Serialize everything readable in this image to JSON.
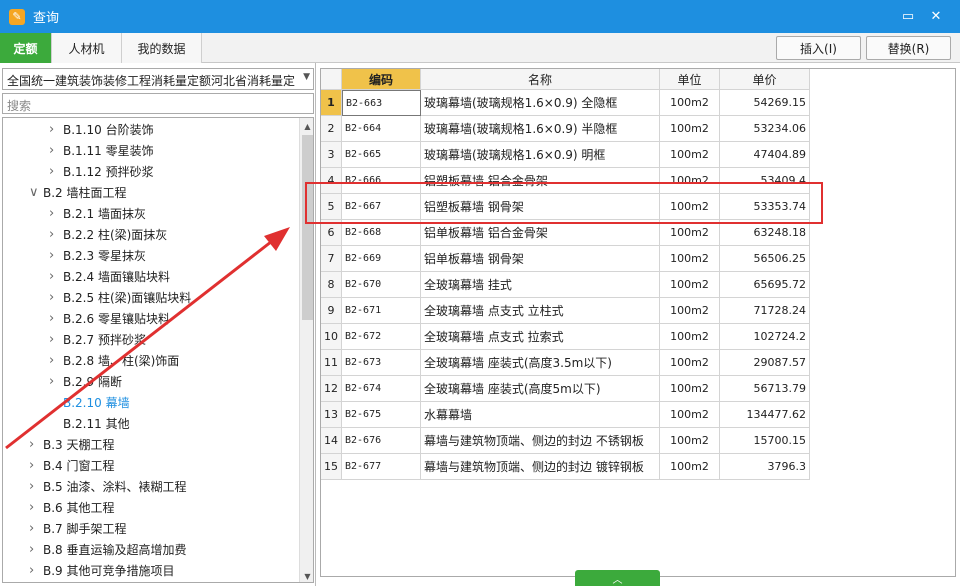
{
  "window": {
    "title": "查询",
    "app_icon": "app-icon",
    "minimize_icon": "▭",
    "close_icon": "✕"
  },
  "tabs": [
    {
      "label": "定额",
      "active": true
    },
    {
      "label": "人材机",
      "active": false
    },
    {
      "label": "我的数据",
      "active": false
    }
  ],
  "buttons": {
    "insert": "插入(I)",
    "replace": "替换(R)"
  },
  "library_select": {
    "value": "全国统一建筑装饰装修工程消耗量定额河北省消耗量定"
  },
  "search": {
    "placeholder": "搜索"
  },
  "tree": [
    {
      "label": "B.1.10 台阶装饰",
      "level": 2,
      "expanded": false
    },
    {
      "label": "B.1.11 零星装饰",
      "level": 2,
      "expanded": false
    },
    {
      "label": "B.1.12 预拌砂浆",
      "level": 2,
      "expanded": false
    },
    {
      "label": "B.2 墙柱面工程",
      "level": 1,
      "expanded": true
    },
    {
      "label": "B.2.1 墙面抹灰",
      "level": 2,
      "expanded": false
    },
    {
      "label": "B.2.2 柱(梁)面抹灰",
      "level": 2,
      "expanded": false
    },
    {
      "label": "B.2.3 零星抹灰",
      "level": 2,
      "expanded": false
    },
    {
      "label": "B.2.4 墙面镶贴块料",
      "level": 2,
      "expanded": false
    },
    {
      "label": "B.2.5 柱(梁)面镶贴块料",
      "level": 2,
      "expanded": false
    },
    {
      "label": "B.2.6 零星镶贴块料",
      "level": 2,
      "expanded": false
    },
    {
      "label": "B.2.7 预拌砂浆",
      "level": 2,
      "expanded": false
    },
    {
      "label": "B.2.8 墙、柱(梁)饰面",
      "level": 2,
      "expanded": false
    },
    {
      "label": "B.2.9 隔断",
      "level": 2,
      "expanded": false
    },
    {
      "label": "B.2.10 幕墙",
      "level": 2,
      "leaf": true,
      "selected": true
    },
    {
      "label": "B.2.11 其他",
      "level": 2,
      "leaf": true
    },
    {
      "label": "B.3 天棚工程",
      "level": 1,
      "expanded": false
    },
    {
      "label": "B.4 门窗工程",
      "level": 1,
      "expanded": false
    },
    {
      "label": "B.5 油漆、涂料、裱糊工程",
      "level": 1,
      "expanded": false
    },
    {
      "label": "B.6 其他工程",
      "level": 1,
      "expanded": false
    },
    {
      "label": "B.7 脚手架工程",
      "level": 1,
      "expanded": false
    },
    {
      "label": "B.8 垂直运输及超高增加费",
      "level": 1,
      "expanded": false
    },
    {
      "label": "B.9 其他可竞争措施项目",
      "level": 1,
      "expanded": false
    }
  ],
  "table": {
    "headers": {
      "code": "编码",
      "name": "名称",
      "unit": "单位",
      "price": "单价"
    },
    "rows": [
      {
        "no": "1",
        "code": "B2-663",
        "name": "玻璃幕墙(玻璃规格1.6×0.9) 全隐框",
        "unit": "100m2",
        "price": "54269.15"
      },
      {
        "no": "2",
        "code": "B2-664",
        "name": "玻璃幕墙(玻璃规格1.6×0.9) 半隐框",
        "unit": "100m2",
        "price": "53234.06"
      },
      {
        "no": "3",
        "code": "B2-665",
        "name": "玻璃幕墙(玻璃规格1.6×0.9) 明框",
        "unit": "100m2",
        "price": "47404.89"
      },
      {
        "no": "4",
        "code": "B2-666",
        "name": "铝塑板幕墙 铝合金骨架",
        "unit": "100m2",
        "price": "53409.4"
      },
      {
        "no": "5",
        "code": "B2-667",
        "name": "铝塑板幕墙 钢骨架",
        "unit": "100m2",
        "price": "53353.74"
      },
      {
        "no": "6",
        "code": "B2-668",
        "name": "铝单板幕墙 铝合金骨架",
        "unit": "100m2",
        "price": "63248.18"
      },
      {
        "no": "7",
        "code": "B2-669",
        "name": "铝单板幕墙 钢骨架",
        "unit": "100m2",
        "price": "56506.25"
      },
      {
        "no": "8",
        "code": "B2-670",
        "name": "全玻璃幕墙 挂式",
        "unit": "100m2",
        "price": "65695.72"
      },
      {
        "no": "9",
        "code": "B2-671",
        "name": "全玻璃幕墙 点支式 立柱式",
        "unit": "100m2",
        "price": "71728.24"
      },
      {
        "no": "10",
        "code": "B2-672",
        "name": "全玻璃幕墙 点支式 拉索式",
        "unit": "100m2",
        "price": "102724.2"
      },
      {
        "no": "11",
        "code": "B2-673",
        "name": "全玻璃幕墙 座装式(高度3.5m以下)",
        "unit": "100m2",
        "price": "29087.57"
      },
      {
        "no": "12",
        "code": "B2-674",
        "name": "全玻璃幕墙 座装式(高度5m以下)",
        "unit": "100m2",
        "price": "56713.79"
      },
      {
        "no": "13",
        "code": "B2-675",
        "name": "水幕幕墙",
        "unit": "100m2",
        "price": "134477.62"
      },
      {
        "no": "14",
        "code": "B2-676",
        "name": "幕墙与建筑物顶端、侧边的封边 不锈钢板",
        "unit": "100m2",
        "price": "15700.15"
      },
      {
        "no": "15",
        "code": "B2-677",
        "name": "幕墙与建筑物顶端、侧边的封边 镀锌钢板",
        "unit": "100m2",
        "price": "3796.3"
      }
    ]
  },
  "colors": {
    "titlebar": "#1e8fe0",
    "active_tab": "#3caa3c",
    "header_highlight": "#f0c24a",
    "annotation": "#e03030"
  }
}
